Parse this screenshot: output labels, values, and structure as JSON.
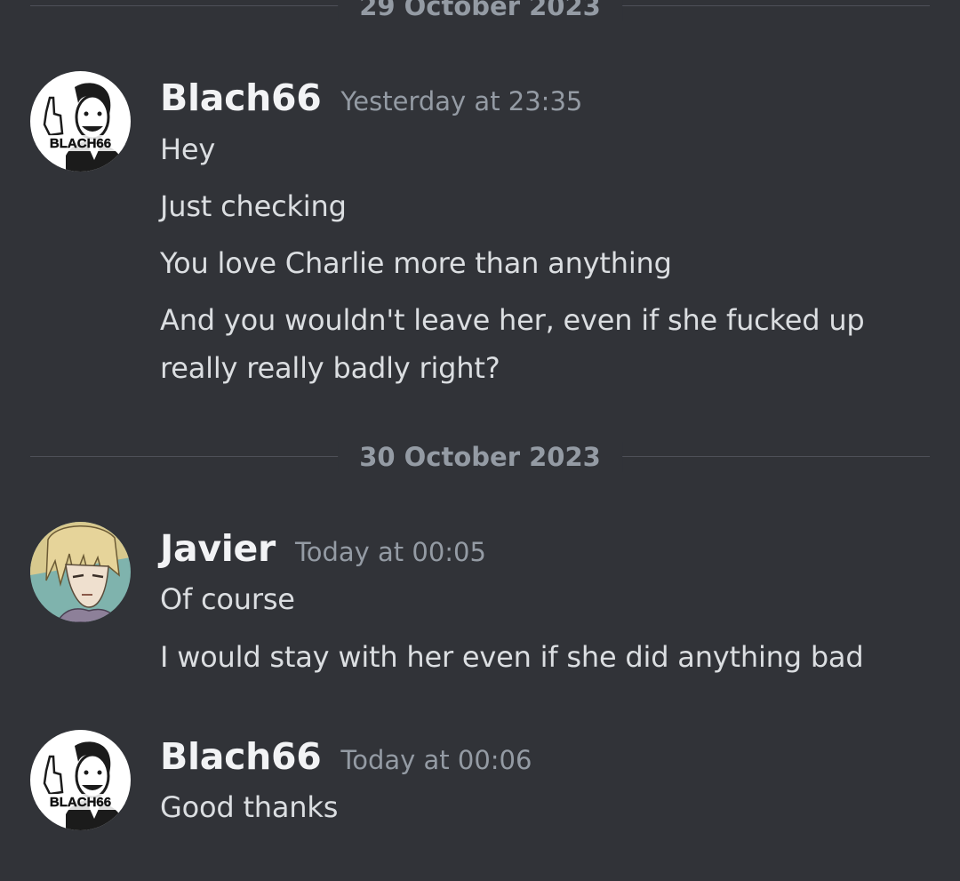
{
  "dividers": [
    {
      "label": "29 October 2023"
    },
    {
      "label": "30 October 2023"
    }
  ],
  "groups": [
    {
      "username": "Blach66",
      "timestamp": "Yesterday at 23:35",
      "avatar_text": "BLACH66",
      "messages": [
        "Hey",
        "Just checking",
        "You love Charlie more than anything",
        "And you wouldn't leave her, even if she fucked up really really badly right?"
      ]
    },
    {
      "username": "Javier",
      "timestamp": "Today at 00:05",
      "messages": [
        "Of course",
        "I would stay with her even if she did anything bad"
      ]
    },
    {
      "username": "Blach66",
      "timestamp": "Today at 00:06",
      "avatar_text": "BLACH66",
      "messages": [
        "Good thanks"
      ]
    }
  ],
  "colors": {
    "background": "#313338",
    "username": "#f2f3f5",
    "timestamp": "#949ba4",
    "message_text": "#dbdee1",
    "divider": "#4e5058"
  }
}
